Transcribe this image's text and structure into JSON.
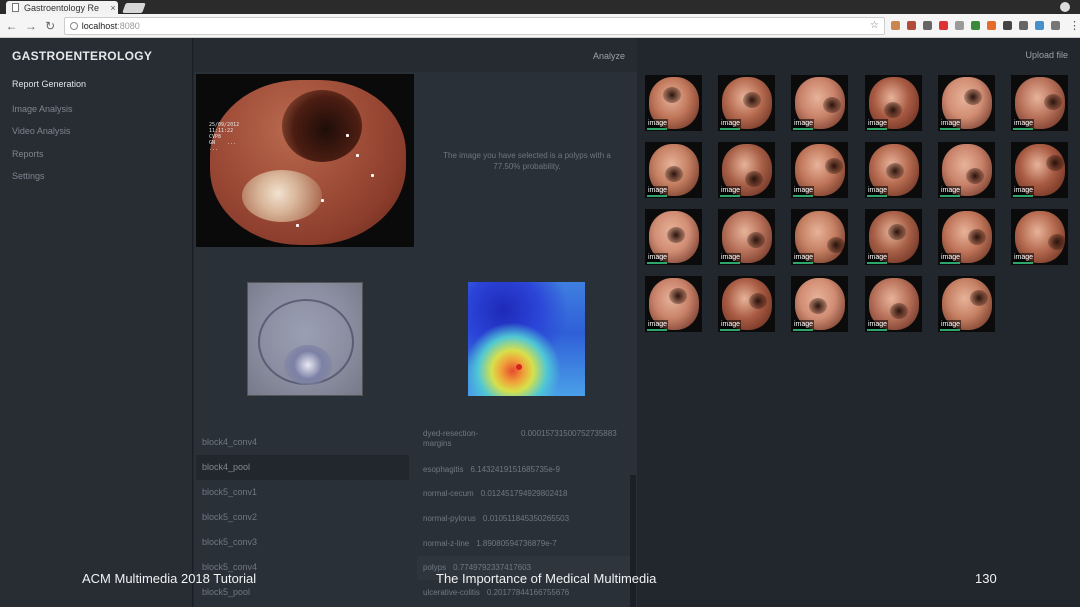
{
  "browser": {
    "tab_title": "Gastroentology Re",
    "tab_close": "×",
    "url_host": "localhost",
    "url_port": ":8080",
    "back": "←",
    "forward": "→",
    "reload": "↻",
    "star": "☆",
    "menu": "⋮"
  },
  "sidebar": {
    "brand": "GASTROENTEROLOGY",
    "items": [
      {
        "label": "Report Generation",
        "active": true
      },
      {
        "label": "Image Analysis"
      },
      {
        "label": "Video Analysis"
      },
      {
        "label": "Reports"
      },
      {
        "label": "Settings"
      }
    ]
  },
  "center": {
    "analyze_label": "Analyze",
    "selected_image_osd": "25/09/2012\n11:11:22\nCVP8\nGN    ...\n...",
    "prediction_text": "The image you have selected is a polyps with a 77.50% probability."
  },
  "layers": [
    {
      "label": "block4_conv4"
    },
    {
      "label": "block4_pool",
      "selected": true
    },
    {
      "label": "block5_conv1"
    },
    {
      "label": "block5_conv2"
    },
    {
      "label": "block5_conv3"
    },
    {
      "label": "block5_conv4"
    },
    {
      "label": "block5_pool"
    }
  ],
  "probabilities": [
    {
      "cls": "dyed-resection-margins",
      "val": "0.00015731500752735883"
    },
    {
      "cls": "esophagitis",
      "val": "6.1432419151685735e-9"
    },
    {
      "cls": "normal-cecum",
      "val": "0.012451794929802418"
    },
    {
      "cls": "normal-pylorus",
      "val": "0.010511845350265503"
    },
    {
      "cls": "normal-z-line",
      "val": "1.89080594736879e-7"
    },
    {
      "cls": "polyps",
      "val": "0.7749792337417603"
    },
    {
      "cls": "ulcerative-colitis",
      "val": "0.20177844166755676"
    }
  ],
  "right": {
    "upload_label": "Upload file",
    "thumb_label": "image",
    "thumbnails_count_rows": [
      6,
      6,
      6,
      5
    ]
  },
  "slide_footer": {
    "left": "ACM Multimedia 2018 Tutorial",
    "center": "The Importance of Medical Multimedia",
    "page": "130"
  },
  "colors": {
    "app_bg": "#22272e",
    "sidebar_bg": "#282d34",
    "panel_bg": "#2a3038",
    "text_active": "#e2e4e7",
    "text_muted": "#7d858f"
  }
}
